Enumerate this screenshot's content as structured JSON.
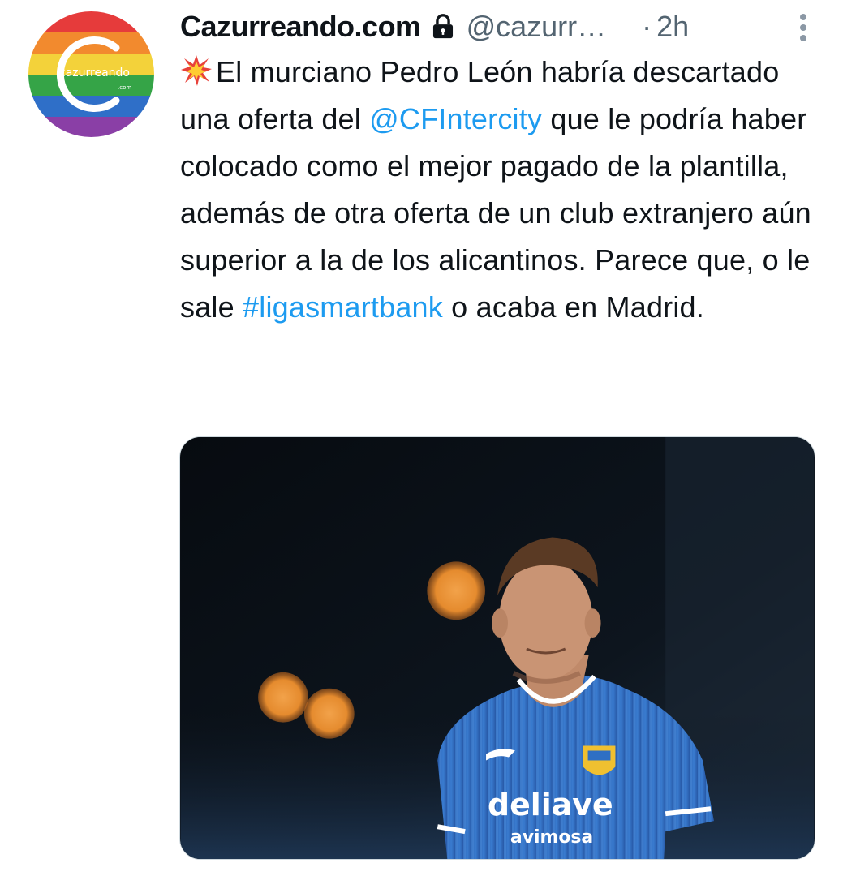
{
  "tweet": {
    "author": {
      "display_name": "Cazurreando.com",
      "handle": "@cazurr…",
      "avatar_text": "cazurreando",
      "avatar_subtext": ".com",
      "protected_icon": "lock-icon"
    },
    "separator": "·",
    "time": "2h",
    "more_icon": "vertical-ellipsis-icon",
    "text": {
      "emoji": "collision-emoji",
      "segment_1": "El murciano Pedro León habría descartado una oferta del ",
      "mention": "@CFIntercity",
      "segment_2": " que le podría haber colocado como el mejor pagado de la plantilla, además de otra oferta de un club extranjero aún superior a la de los alicantinos. Parece que, o le sale ",
      "hashtag": "#ligasmartbank",
      "segment_3": " o acaba en Madrid."
    },
    "media": {
      "jersey_sponsor_line1": "deliave",
      "jersey_sponsor_line2": "avimosa"
    }
  },
  "colors": {
    "link": "#1d9bf0",
    "secondary_text": "#536471",
    "primary_text": "#0f1419",
    "jersey_blue": "#2f6fc4"
  }
}
